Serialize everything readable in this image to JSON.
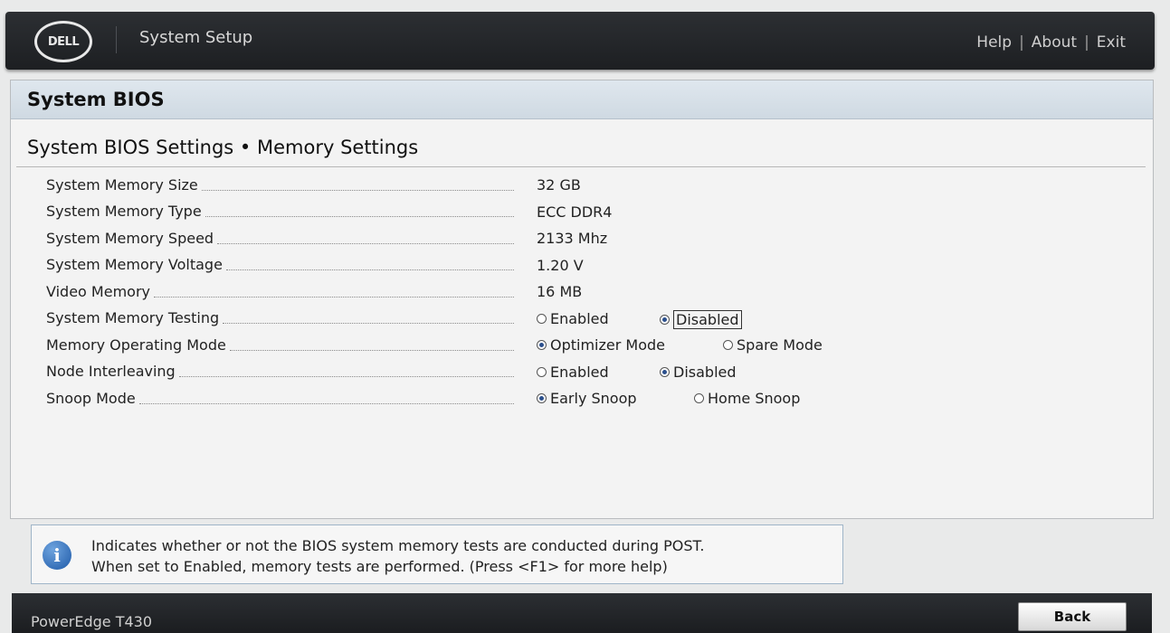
{
  "header": {
    "logo": "DELL",
    "app_title": "System Setup",
    "links": {
      "help": "Help",
      "about": "About",
      "exit": "Exit",
      "separator": "|"
    }
  },
  "panel": {
    "title": "System BIOS",
    "subtitle": "System BIOS Settings • Memory Settings"
  },
  "settings": [
    {
      "label": "System Memory Size",
      "value": "32 GB"
    },
    {
      "label": "System Memory Type",
      "value": "ECC DDR4"
    },
    {
      "label": "System Memory Speed",
      "value": "2133 Mhz"
    },
    {
      "label": "System Memory Voltage",
      "value": "1.20 V"
    },
    {
      "label": "Video Memory",
      "value": "16 MB"
    },
    {
      "label": "System Memory Testing",
      "options": [
        "Enabled",
        "Disabled"
      ],
      "selected": "Disabled"
    },
    {
      "label": "Memory Operating Mode",
      "options": [
        "Optimizer Mode",
        "Spare Mode"
      ],
      "selected": "Optimizer Mode"
    },
    {
      "label": "Node Interleaving",
      "options": [
        "Enabled",
        "Disabled"
      ],
      "selected": "Disabled"
    },
    {
      "label": "Snoop Mode",
      "options": [
        "Early Snoop",
        "Home Snoop"
      ],
      "selected": "Early Snoop"
    }
  ],
  "help": {
    "icon": "info-icon",
    "line1": "Indicates whether or not the BIOS system memory tests are conducted during POST.",
    "line2": "When set to Enabled, memory tests are performed. (Press <F1> for more help)"
  },
  "footer": {
    "model": "PowerEdge T430",
    "back_label": "Back"
  }
}
